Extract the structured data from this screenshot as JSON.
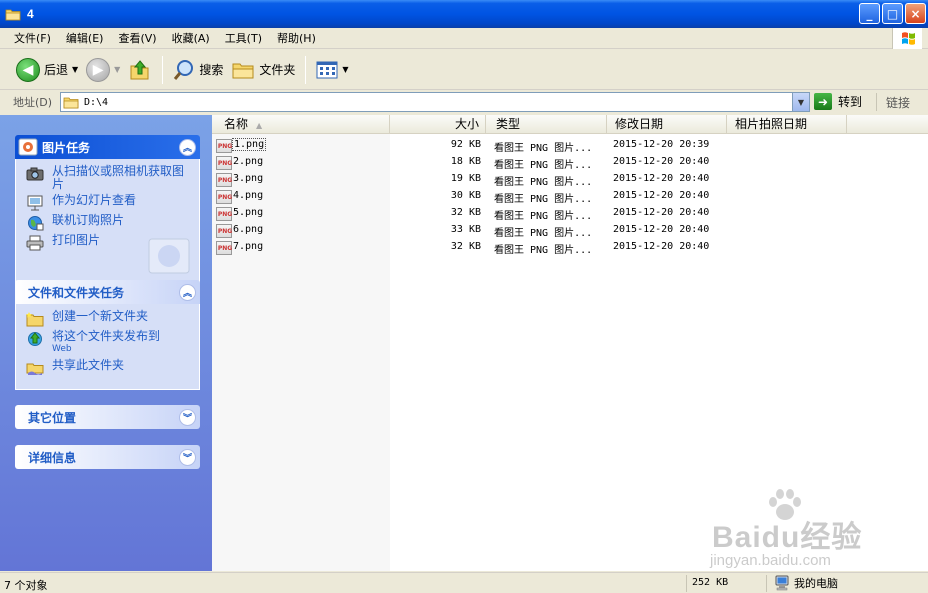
{
  "window": {
    "title": "4",
    "controls": {
      "minimize": "_",
      "maximize": "□",
      "close": "×"
    }
  },
  "menubar": [
    "文件(F)",
    "编辑(E)",
    "查看(V)",
    "收藏(A)",
    "工具(T)",
    "帮助(H)"
  ],
  "toolbar": {
    "back_label": "后退",
    "search_label": "搜索",
    "folders_label": "文件夹"
  },
  "address": {
    "label": "地址(D)",
    "path": "D:\\4",
    "go_label": "转到",
    "links_label": "链接"
  },
  "tasks": {
    "picture_tasks": {
      "title": "图片任务",
      "items": [
        {
          "label": "从扫描仪或照相机获取图片",
          "icon": "camera-icon"
        },
        {
          "label": "作为幻灯片查看",
          "icon": "slideshow-icon"
        },
        {
          "label": "联机订购照片",
          "icon": "globe-order-icon"
        },
        {
          "label": "打印图片",
          "icon": "printer-icon"
        }
      ]
    },
    "file_folder_tasks": {
      "title": "文件和文件夹任务",
      "items": [
        {
          "label": "创建一个新文件夹",
          "icon": "new-folder-icon"
        },
        {
          "label": "将这个文件夹发布到",
          "sub": "Web",
          "icon": "publish-web-icon"
        },
        {
          "label": "共享此文件夹",
          "icon": "share-folder-icon"
        }
      ]
    },
    "other_places": {
      "title": "其它位置"
    },
    "details": {
      "title": "详细信息"
    }
  },
  "columns": {
    "name": "名称",
    "size": "大小",
    "type": "类型",
    "modified": "修改日期",
    "taken": "相片拍照日期"
  },
  "files": [
    {
      "name": "1.png",
      "size": "92 KB",
      "type": "看图王 PNG 图片...",
      "modified": "2015-12-20 20:39"
    },
    {
      "name": "2.png",
      "size": "18 KB",
      "type": "看图王 PNG 图片...",
      "modified": "2015-12-20 20:40"
    },
    {
      "name": "3.png",
      "size": "19 KB",
      "type": "看图王 PNG 图片...",
      "modified": "2015-12-20 20:40"
    },
    {
      "name": "4.png",
      "size": "30 KB",
      "type": "看图王 PNG 图片...",
      "modified": "2015-12-20 20:40"
    },
    {
      "name": "5.png",
      "size": "32 KB",
      "type": "看图王 PNG 图片...",
      "modified": "2015-12-20 20:40"
    },
    {
      "name": "6.png",
      "size": "33 KB",
      "type": "看图王 PNG 图片...",
      "modified": "2015-12-20 20:40"
    },
    {
      "name": "7.png",
      "size": "32 KB",
      "type": "看图王 PNG 图片...",
      "modified": "2015-12-20 20:40"
    }
  ],
  "status": {
    "count": "7 个对象",
    "size": "252 KB",
    "location": "我的电脑"
  },
  "watermark": {
    "main": "Baidu经验",
    "sub": "jingyan.baidu.com"
  },
  "colors": {
    "titlebar": "#0054e3",
    "taskpane": "#6f8ee0",
    "link": "#215dc6"
  }
}
